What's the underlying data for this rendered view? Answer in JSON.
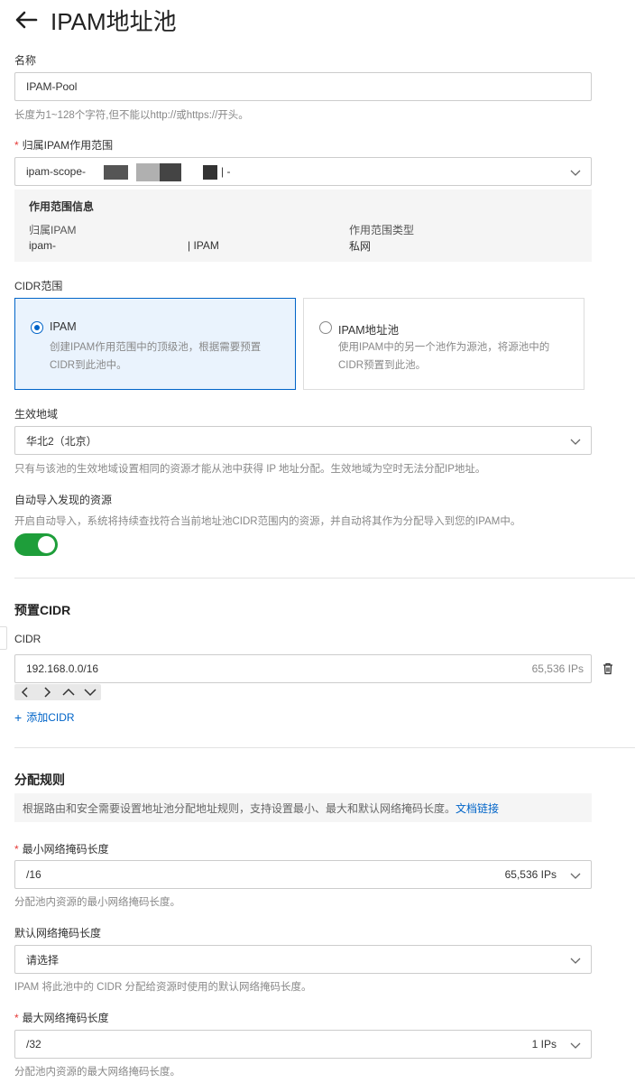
{
  "header": {
    "title": "IPAM地址池"
  },
  "name_field": {
    "label": "名称",
    "value": "IPAM-Pool",
    "hint": "长度为1~128个字符,但不能以http://或https://开头。"
  },
  "scope_field": {
    "label": "归属IPAM作用范围",
    "value_prefix": "ipam-scope-",
    "value_suffix": "| -"
  },
  "scope_info": {
    "heading": "作用范围信息",
    "ipam_label": "归属IPAM",
    "ipam_value_prefix": "ipam-",
    "ipam_value_suffix": "|  IPAM",
    "type_label": "作用范围类型",
    "type_value": "私网"
  },
  "cidr_scope": {
    "label": "CIDR范围",
    "options": [
      {
        "title": "IPAM",
        "desc": "创建IPAM作用范围中的顶级池，根据需要预置CIDR到此池中。",
        "selected": true
      },
      {
        "title": "IPAM地址池",
        "desc": "使用IPAM中的另一个池作为源池，将源池中的CIDR预置到此池。",
        "selected": false
      }
    ]
  },
  "region_field": {
    "label": "生效地域",
    "value": "华北2（北京）",
    "hint": "只有与该池的生效地域设置相同的资源才能从池中获得 IP 地址分配。生效地域为空时无法分配IP地址。"
  },
  "auto_import": {
    "label": "自动导入发现的资源",
    "hint": "开启自动导入，系统将持续查找符合当前地址池CIDR范围内的资源，并自动将其作为分配导入到您的IPAM中。",
    "enabled": true
  },
  "preset_cidr": {
    "title": "预置CIDR",
    "label": "CIDR",
    "value": "192.168.0.0/16",
    "count": "65,536 IPs",
    "add_label": "添加CIDR"
  },
  "allocation": {
    "title": "分配规则",
    "tip": "根据路由和安全需要设置地址池分配地址规则，支持设置最小、最大和默认网络掩码长度。",
    "tip_link": "文档链接",
    "min": {
      "label": "最小网络掩码长度",
      "value": "/16",
      "count": "65,536 IPs",
      "hint": "分配池内资源的最小网络掩码长度。"
    },
    "default": {
      "label": "默认网络掩码长度",
      "placeholder": "请选择",
      "hint": "IPAM 将此池中的 CIDR 分配给资源时使用的默认网络掩码长度。"
    },
    "max": {
      "label": "最大网络掩码长度",
      "value": "/32",
      "count": "1 IPs",
      "hint": "分配池内资源的最大网络掩码长度。"
    }
  },
  "colors": {
    "accent": "#0064c8",
    "toggle_on": "#1e9e3a",
    "required": "#e53935"
  }
}
